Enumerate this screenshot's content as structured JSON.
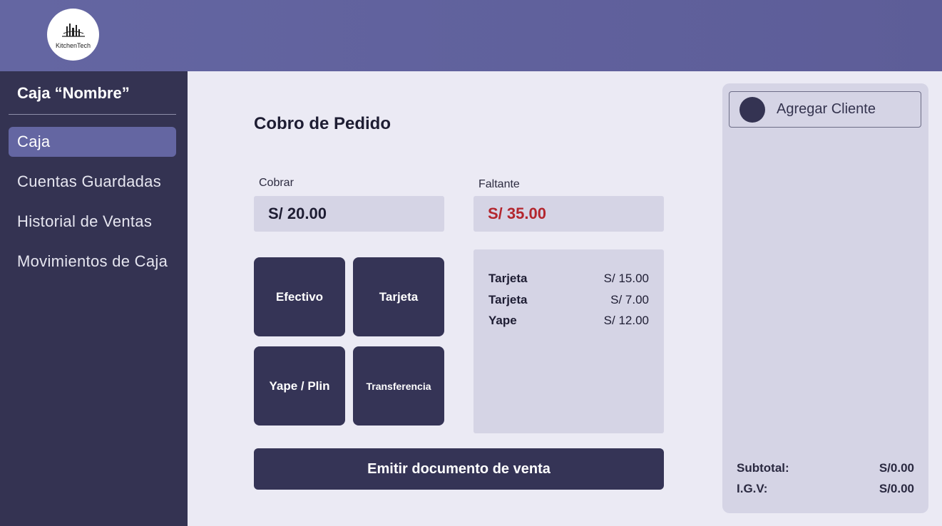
{
  "header": {
    "logo_text": "KitchenTech"
  },
  "sidebar": {
    "title": "Caja “Nombre”",
    "items": [
      {
        "label": "Caja",
        "active": true
      },
      {
        "label": "Cuentas Guardadas",
        "active": false
      },
      {
        "label": "Historial de Ventas",
        "active": false
      },
      {
        "label": "Movimientos de Caja",
        "active": false
      }
    ]
  },
  "main": {
    "title": "Cobro de Pedido",
    "cobrar": {
      "label": "Cobrar",
      "value": "S/ 20.00"
    },
    "faltante": {
      "label": "Faltante",
      "value": "S/ 35.00"
    },
    "payment_buttons": [
      "Efectivo",
      "Tarjeta",
      "Yape / Plin",
      "Transferencia"
    ],
    "payments": [
      {
        "method": "Tarjeta",
        "amount": "S/ 15.00"
      },
      {
        "method": "Tarjeta",
        "amount": "S/ 7.00"
      },
      {
        "method": "Yape",
        "amount": "S/ 12.00"
      }
    ],
    "emit_label": "Emitir documento de venta"
  },
  "right_panel": {
    "client_label": "Agregar Cliente",
    "subtotal_label": "Subtotal:",
    "subtotal_value": "S/0.00",
    "igv_label": "I.G.V:",
    "igv_value": "S/0.00"
  },
  "colors": {
    "sidebar_bg": "#343352",
    "accent": "#6466a2",
    "button_bg": "#353456",
    "faltante_red": "#b3262e",
    "panel_bg": "#d5d4e5"
  }
}
